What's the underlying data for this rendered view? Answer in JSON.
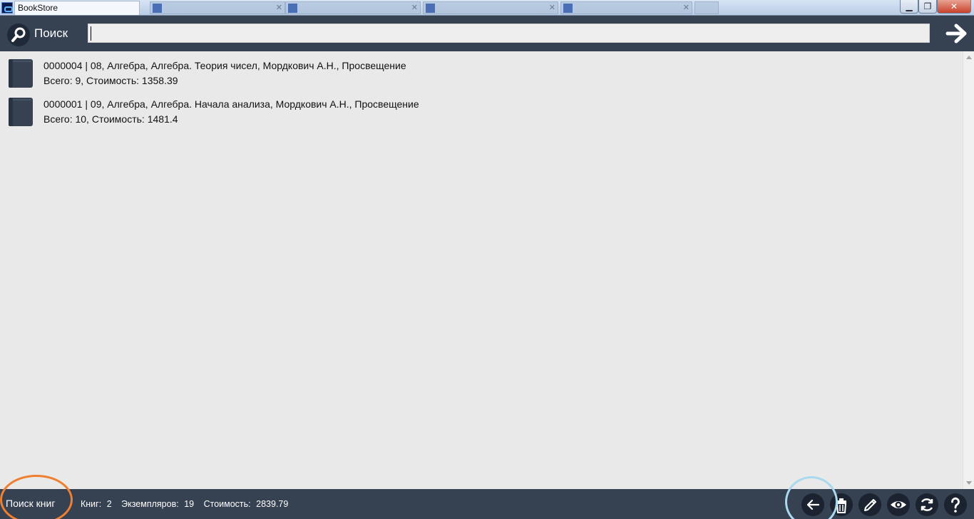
{
  "window": {
    "title": "BookStore",
    "controls": {
      "minimize": "▁",
      "maximize": "❐",
      "close": "✕"
    }
  },
  "search": {
    "label": "Поиск",
    "value": "",
    "icons": {
      "search": "search-icon",
      "submit": "arrow-right-icon"
    }
  },
  "books": [
    {
      "line1": "0000004 | 08, Алгебра, Алгебра. Теория чисел, Мордкович А.Н., Просвещение",
      "line2": "Всего: 9, Стоимость: 1358.39",
      "icon": "book-icon"
    },
    {
      "line1": "0000001 | 09, Алгебра, Алгебра. Начала анализа, Мордкович А.Н., Просвещение",
      "line2": "Всего: 10, Стоимость: 1481.4",
      "icon": "book-icon"
    }
  ],
  "footer": {
    "mode": "Поиск книг",
    "stats": {
      "books_label": "Книг:",
      "books_value": "2",
      "copies_label": "Экземпляров:",
      "copies_value": "19",
      "cost_label": "Стоимость:",
      "cost_value": "2839.79"
    },
    "tools": [
      "back-icon",
      "trash-icon",
      "pencil-icon",
      "eye-icon",
      "refresh-icon",
      "help-icon"
    ]
  },
  "colors": {
    "bar": "#364152",
    "icon_bg": "#1b2330",
    "list_bg": "#e9e9e9",
    "book": "#364152",
    "highlight_orange": "#f07f2f",
    "highlight_blue": "#a9d8ef"
  }
}
